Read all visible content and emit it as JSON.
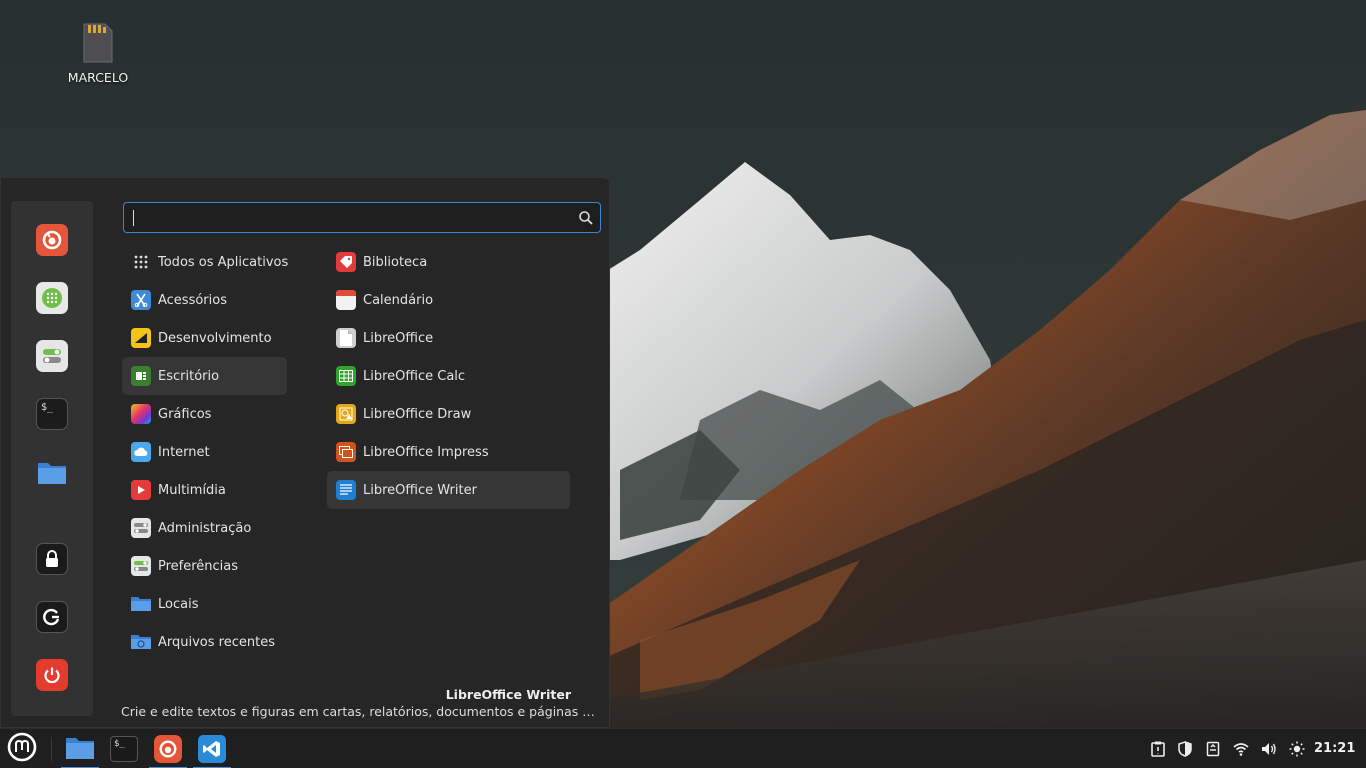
{
  "desktop": {
    "icons": [
      {
        "label": "MARCELO",
        "icon": "sd-card-icon"
      }
    ]
  },
  "menu": {
    "search": {
      "value": "",
      "placeholder": ""
    },
    "favorites": [
      {
        "name": "firefox",
        "icon": "firefox-icon"
      },
      {
        "name": "software-manager",
        "icon": "software-manager-icon"
      },
      {
        "name": "system-settings",
        "icon": "settings-icon"
      },
      {
        "name": "terminal",
        "icon": "terminal-icon"
      },
      {
        "name": "files",
        "icon": "folder-icon"
      },
      {
        "name": "lock-screen",
        "icon": "lock-icon"
      },
      {
        "name": "logout",
        "icon": "logout-icon"
      },
      {
        "name": "shutdown",
        "icon": "power-icon"
      }
    ],
    "categories": [
      {
        "label": "Todos os Aplicativos",
        "icon": "grid-icon"
      },
      {
        "label": "Acessórios",
        "icon": "accessories-icon"
      },
      {
        "label": "Desenvolvimento",
        "icon": "development-icon"
      },
      {
        "label": "Escritório",
        "icon": "office-icon",
        "selected": true
      },
      {
        "label": "Gráficos",
        "icon": "graphics-icon"
      },
      {
        "label": "Internet",
        "icon": "internet-icon"
      },
      {
        "label": "Multimídia",
        "icon": "multimedia-icon"
      },
      {
        "label": "Administração",
        "icon": "administration-icon"
      },
      {
        "label": "Preferências",
        "icon": "preferences-icon"
      },
      {
        "label": "Locais",
        "icon": "places-icon"
      },
      {
        "label": "Arquivos recentes",
        "icon": "recent-files-icon"
      }
    ],
    "apps": [
      {
        "label": "Biblioteca",
        "icon": "library-icon"
      },
      {
        "label": "Calendário",
        "icon": "calendar-icon"
      },
      {
        "label": "LibreOffice",
        "icon": "libreoffice-icon"
      },
      {
        "label": "LibreOffice Calc",
        "icon": "calc-icon"
      },
      {
        "label": "LibreOffice Draw",
        "icon": "draw-icon"
      },
      {
        "label": "LibreOffice Impress",
        "icon": "impress-icon"
      },
      {
        "label": "LibreOffice Writer",
        "icon": "writer-icon",
        "selected": true
      }
    ],
    "description": {
      "title": "LibreOffice Writer",
      "text": "Crie e edite textos e figuras em cartas, relatórios, documentos e páginas …"
    }
  },
  "taskbar": {
    "launchers": [
      {
        "name": "menu",
        "icon": "mint-menu-icon"
      },
      {
        "name": "files",
        "icon": "folder-icon",
        "active": true
      },
      {
        "name": "terminal",
        "icon": "terminal-icon"
      },
      {
        "name": "firefox",
        "icon": "firefox-icon",
        "active": true
      },
      {
        "name": "vscode",
        "icon": "vscode-icon",
        "active": true
      }
    ],
    "tray": [
      "clipboard-icon",
      "shield-icon",
      "notes-icon",
      "wifi-icon",
      "volume-icon",
      "brightness-icon"
    ],
    "clock": "21:21"
  },
  "colors": {
    "accent": "#3b84d6",
    "menu_bg": "#262626",
    "favbar_bg": "#323232",
    "taskbar_bg": "#1f1f1f"
  }
}
